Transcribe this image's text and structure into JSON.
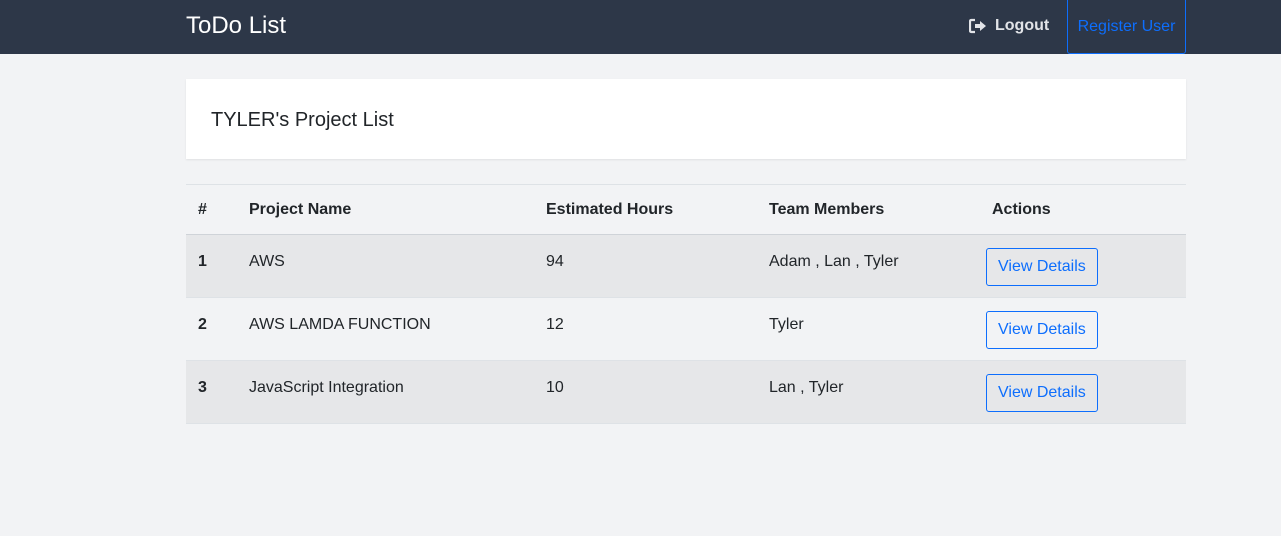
{
  "navbar": {
    "brand": "ToDo List",
    "logout_label": "Logout",
    "register_label": "Register User"
  },
  "page": {
    "title": "TYLER's Project List"
  },
  "table": {
    "headers": [
      "#",
      "Project Name",
      "Estimated Hours",
      "Team Members",
      "Actions"
    ],
    "rows": [
      {
        "num": "1",
        "name": "AWS",
        "hours": "94",
        "members": "Adam , Lan , Tyler",
        "action": "View Details"
      },
      {
        "num": "2",
        "name": "AWS LAMDA FUNCTION",
        "hours": "12",
        "members": "Tyler",
        "action": "View Details"
      },
      {
        "num": "3",
        "name": "JavaScript Integration",
        "hours": "10",
        "members": "Lan , Tyler",
        "action": "View Details"
      }
    ]
  },
  "colors": {
    "navbar_bg": "#2d3748",
    "accent": "#0d6efd",
    "page_bg": "#f2f3f5"
  },
  "icons": {
    "logout": "sign-out-icon"
  }
}
